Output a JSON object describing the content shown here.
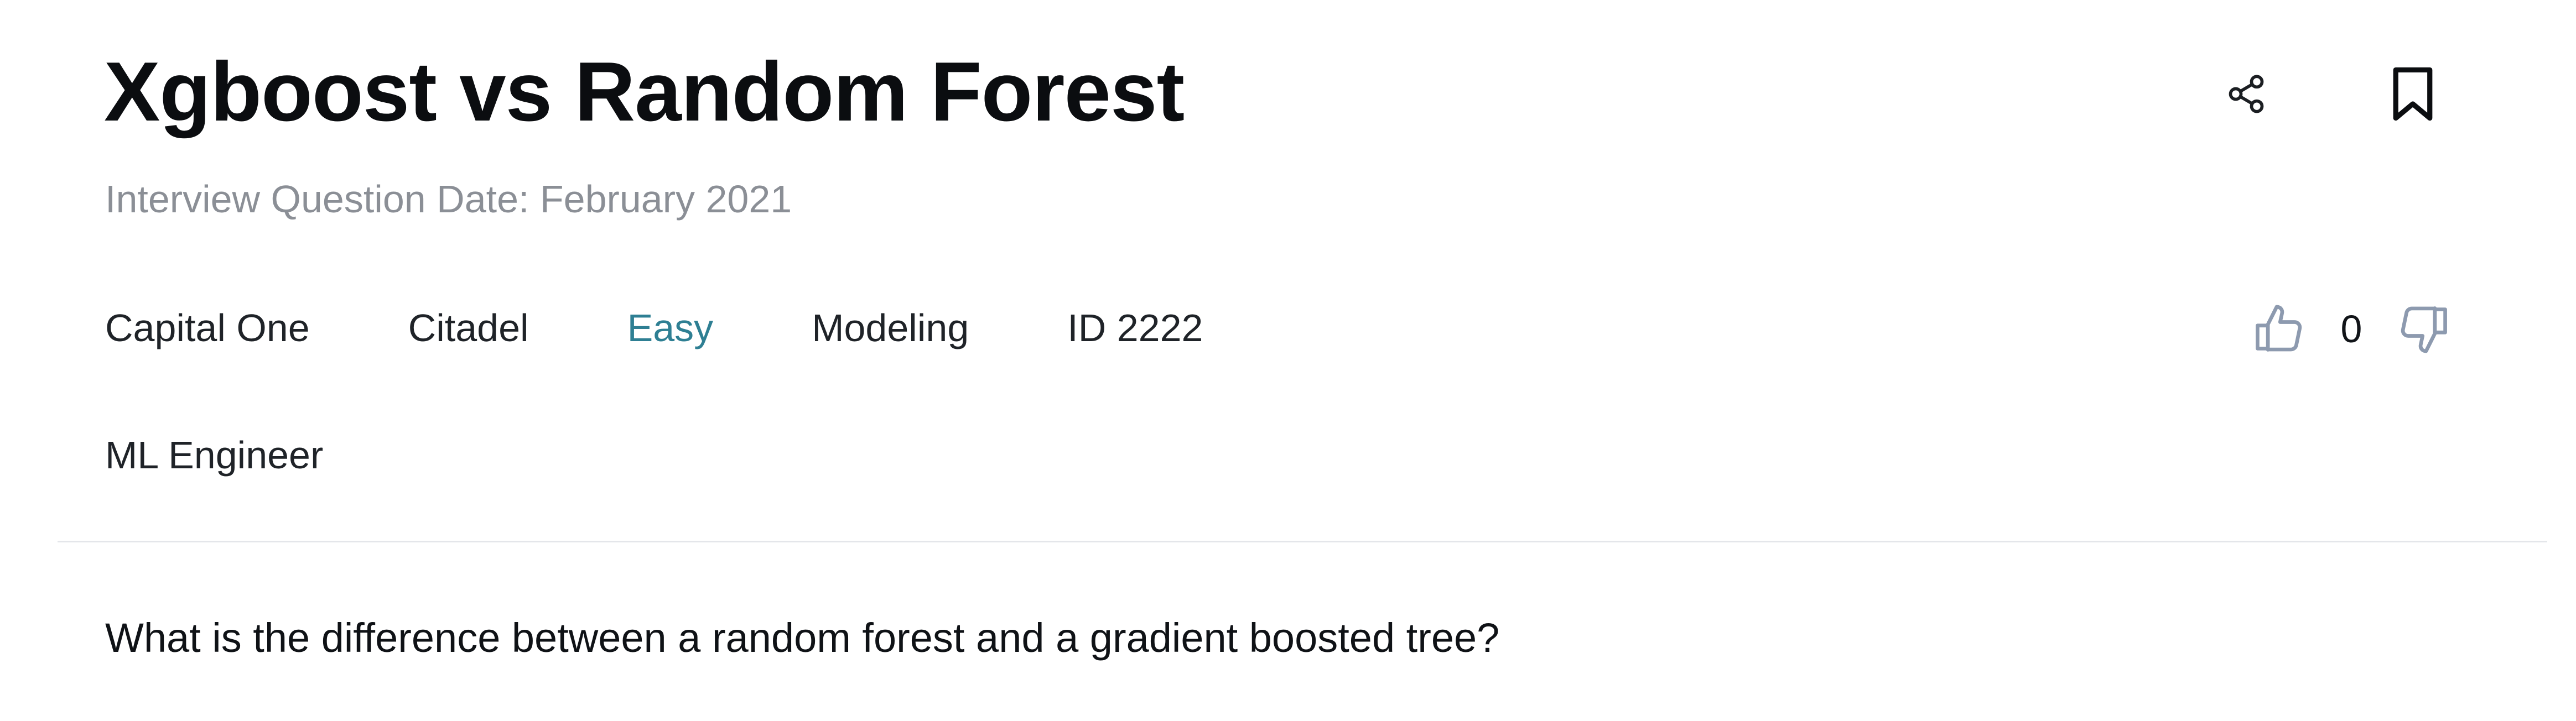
{
  "header": {
    "title": "Xgboost vs Random Forest",
    "date_line": "Interview Question Date: February 2021",
    "actions": {
      "share_icon": "share-icon",
      "bookmark_icon": "bookmark-icon"
    }
  },
  "tags": {
    "company_1": "Capital One",
    "company_2": "Citadel",
    "difficulty": "Easy",
    "category": "Modeling",
    "id": "ID 2222",
    "role": "ML Engineer"
  },
  "votes": {
    "upvote_icon": "thumbs-up-icon",
    "count": "0",
    "downvote_icon": "thumbs-down-icon"
  },
  "question": {
    "text": "What is the difference between a random forest and a gradient boosted tree?"
  },
  "colors": {
    "difficulty_easy": "#2e7f93",
    "muted_text": "#8b8f96",
    "vote_icon": "#8d9aaf",
    "divider": "#e4e6ea"
  }
}
